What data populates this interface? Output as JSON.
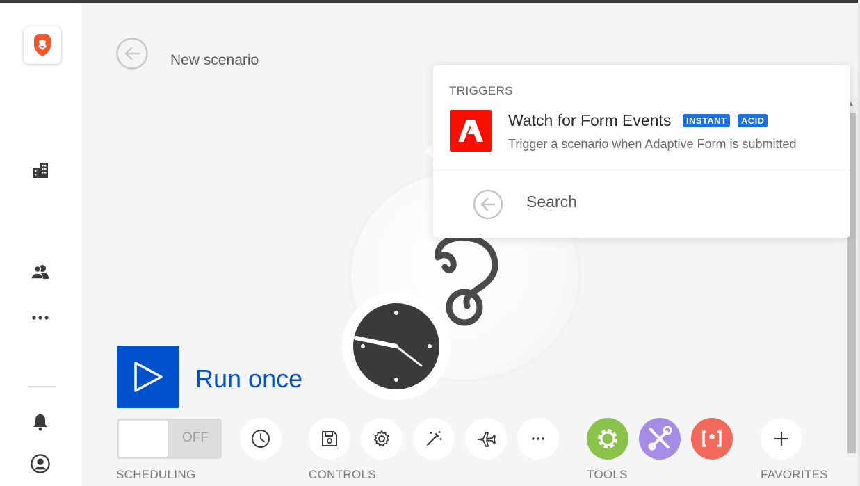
{
  "header": {
    "title": "New scenario"
  },
  "sidebar": {
    "items": [
      {
        "icon": "buildings-icon"
      },
      {
        "icon": "team-icon"
      },
      {
        "icon": "more-dots-icon"
      },
      {
        "icon": "bell-icon"
      },
      {
        "icon": "user-avatar-icon"
      }
    ]
  },
  "run": {
    "label": "Run once"
  },
  "scheduling": {
    "toggle_label": "OFF",
    "section_label": "SCHEDULING"
  },
  "controls": {
    "section_label": "CONTROLS"
  },
  "tools": {
    "section_label": "TOOLS"
  },
  "favorites": {
    "section_label": "FAVORITES"
  },
  "triggers": {
    "heading": "TRIGGERS",
    "item": {
      "title": "Watch for Form Events",
      "badges": [
        "INSTANT",
        "ACID"
      ],
      "description": "Trigger a scenario when Adaptive Form is submitted"
    },
    "search_label": "Search"
  },
  "colors": {
    "accent": "#0052cc",
    "adobe_red": "#fa0f00",
    "badge_blue": "#1a6fe6",
    "tools_green": "#8bc34a",
    "tools_purple": "#a58de6",
    "tools_coral": "#f2685a"
  }
}
